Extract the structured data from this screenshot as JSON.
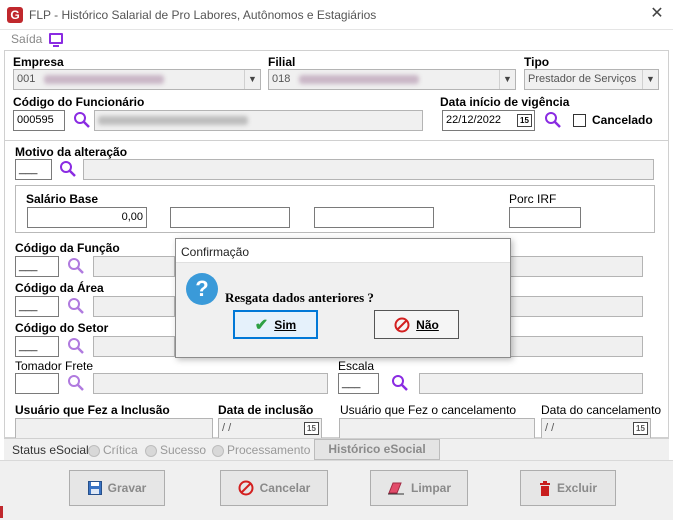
{
  "window": {
    "title": "FLP - Histórico Salarial de Pro Labores, Autônomos e Estagiários",
    "menu_saida": "Saída"
  },
  "form": {
    "empresa_label": "Empresa",
    "empresa_value": "001",
    "filial_label": "Filial",
    "filial_value": "018",
    "tipo_label": "Tipo",
    "tipo_value": "Prestador de Serviços",
    "codigo_funcionario_label": "Código do Funcionário",
    "codigo_funcionario_value": "000595",
    "data_inicio_label": "Data início de vigência",
    "data_inicio_value": "22/12/2022",
    "cancelado_label": "Cancelado",
    "motivo_label": "Motivo da alteração",
    "motivo_code": "___",
    "salario_base_label": "Salário Base",
    "salario_base_value": "0,00",
    "porc_irf_label": "Porc IRF",
    "codigo_funcao_label": "Código da Função",
    "codigo_area_label": "Código da Área",
    "codigo_setor_label": "Código do Setor",
    "tomador_frete_label": "Tomador Frete",
    "escala_label": "Escala",
    "usuario_inclusao_label": "Usuário que Fez a Inclusão",
    "data_inclusao_label": "Data de inclusão",
    "data_inclusao_value": "/ /",
    "usuario_cancelamento_label": "Usuário que Fez o cancelamento",
    "data_cancelamento_label": "Data do cancelamento",
    "data_cancelamento_value": "/ /",
    "calendar_glyph": "15",
    "blank_code": "___"
  },
  "status": {
    "label": "Status eSocial:",
    "opt_critica": "Crítica",
    "opt_sucesso": "Sucesso",
    "opt_processamento": "Processamento",
    "historico_button": "Histórico eSocial"
  },
  "toolbar": {
    "gravar": "Gravar",
    "cancelar": "Cancelar",
    "limpar": "Limpar",
    "excluir": "Excluir"
  },
  "dialog": {
    "title": "Confirmação",
    "message": "Resgata dados anteriores ?",
    "yes": "Sim",
    "no": "Não",
    "icon": "question-icon"
  },
  "colors": {
    "accent_purple": "#8a2be2",
    "dialog_question_blue": "#3a9ad9",
    "dialog_focus_border": "#0078d7",
    "no_icon_red": "#d32020",
    "yes_icon_green": "#2ea043"
  }
}
